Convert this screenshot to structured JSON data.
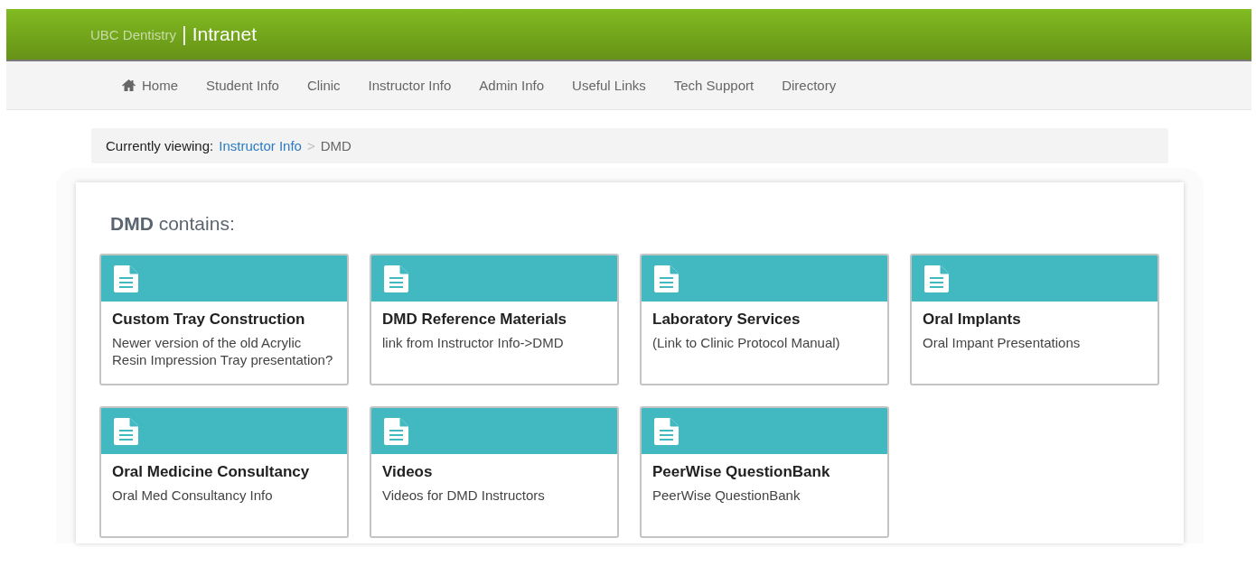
{
  "header": {
    "brand": "UBC Dentistry",
    "separator": "|",
    "title": "Intranet"
  },
  "nav": [
    {
      "label": "Home",
      "kind": "home"
    },
    {
      "label": "Student Info",
      "kind": "plain"
    },
    {
      "label": "Clinic",
      "kind": "plain"
    },
    {
      "label": "Instructor Info",
      "kind": "plain"
    },
    {
      "label": "Admin Info",
      "kind": "plain"
    },
    {
      "label": "Useful Links",
      "kind": "plain"
    },
    {
      "label": "Tech Support",
      "kind": "plain"
    },
    {
      "label": "Directory",
      "kind": "plain"
    }
  ],
  "breadcrumb": {
    "prefix": "Currently viewing:",
    "link": "Instructor Info",
    "separator": ">",
    "current": "DMD"
  },
  "heading": {
    "name": "DMD",
    "suffix": "contains:"
  },
  "cards": [
    {
      "title": "Custom Tray Construction",
      "description": "Newer version of the old Acrylic Resin Impression Tray presentation?"
    },
    {
      "title": "DMD Reference Materials",
      "description": "link from Instructor Info->DMD"
    },
    {
      "title": "Laboratory Services",
      "description": "(Link to Clinic Protocol Manual)"
    },
    {
      "title": "Oral Implants",
      "description": "Oral Impant Presentations"
    },
    {
      "title": "Oral Medicine Consultancy",
      "description": "Oral Med Consultancy Info"
    },
    {
      "title": "Videos",
      "description": "Videos for DMD Instructors"
    },
    {
      "title": "PeerWise QuestionBank",
      "description": "PeerWise QuestionBank"
    }
  ]
}
